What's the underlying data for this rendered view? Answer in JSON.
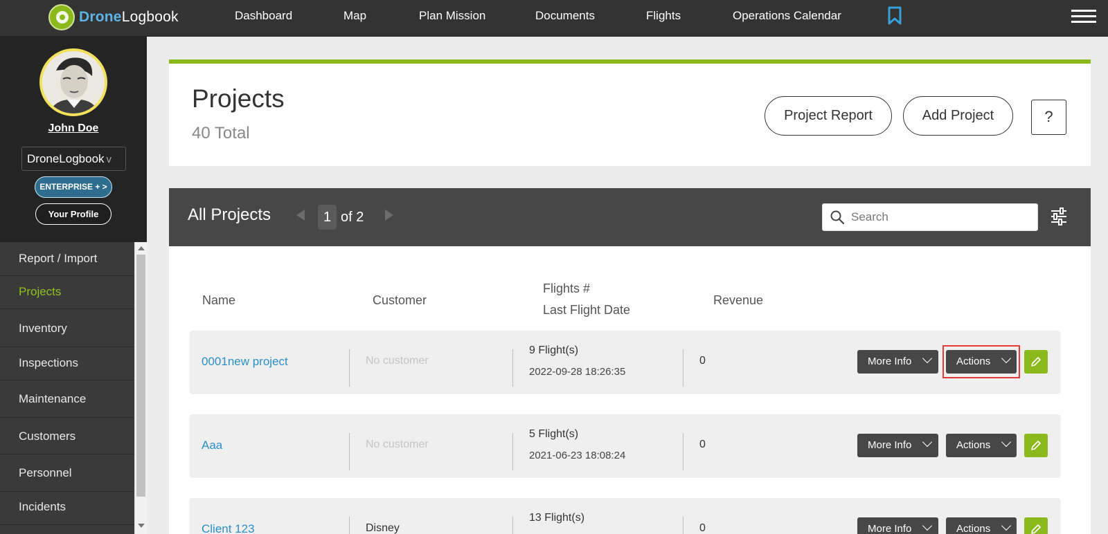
{
  "brand": {
    "part1": "Drone",
    "part2": "Logbook"
  },
  "nav": {
    "items": [
      "Dashboard",
      "Map",
      "Plan Mission",
      "Documents",
      "Flights",
      "Operations Calendar"
    ]
  },
  "user": {
    "name": "John Doe",
    "org": "DroneLogbook",
    "org_chevron": "v",
    "plan_badge": "ENTERPRISE + >",
    "profile_button": "Your Profile"
  },
  "sidebar": {
    "items": [
      {
        "label": "Report / Import",
        "active": false
      },
      {
        "label": "Projects",
        "active": true
      },
      {
        "label": "Inventory",
        "active": false
      },
      {
        "label": "Inspections",
        "active": false
      },
      {
        "label": "Maintenance",
        "active": false
      },
      {
        "label": "Customers",
        "active": false
      },
      {
        "label": "Personnel",
        "active": false
      },
      {
        "label": "Incidents",
        "active": false
      }
    ]
  },
  "header": {
    "title": "Projects",
    "total": "40 Total",
    "project_report_button": "Project Report",
    "add_project_button": "Add Project",
    "help_button": "?"
  },
  "panel": {
    "title": "All Projects",
    "page_current": "1",
    "page_of": "of 2",
    "search_placeholder": "Search"
  },
  "table": {
    "columns": {
      "name": "Name",
      "customer": "Customer",
      "flights": "Flights #",
      "last_flight": "Last Flight Date",
      "revenue": "Revenue"
    },
    "more_info_label": "More Info",
    "actions_label": "Actions",
    "rows": [
      {
        "name": "0001new project",
        "customer": "No customer",
        "flights": "9 Flight(s)",
        "date": "2022-09-28 18:26:35",
        "revenue": "0"
      },
      {
        "name": "Aaa",
        "customer": "No customer",
        "flights": "5 Flight(s)",
        "date": "2021-06-23 18:08:24",
        "revenue": "0"
      },
      {
        "name": "Client 123",
        "customer": "Disney",
        "flights": "13 Flight(s)",
        "date": "",
        "revenue": "0"
      }
    ]
  },
  "colors": {
    "accent_green": "#8bb81a",
    "link_blue": "#2b8ec6",
    "dark": "#333333",
    "highlight_red": "#e53935"
  }
}
